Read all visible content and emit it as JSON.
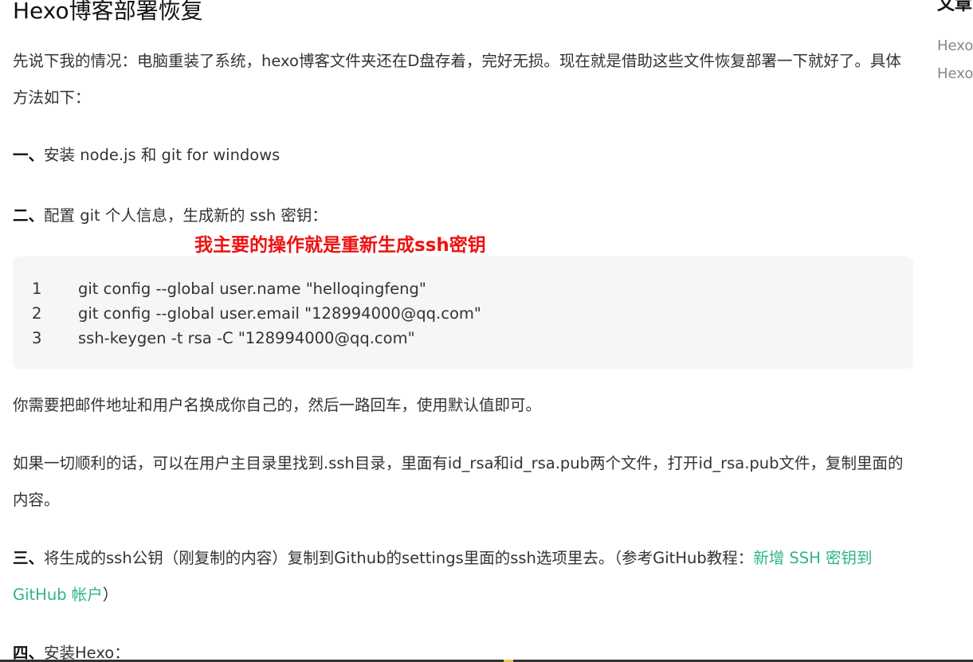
{
  "article": {
    "title": "Hexo博客部署恢复",
    "intro": "先说下我的情况：电脑重装了系统，hexo博客文件夹还在D盘存着，完好无损。现在就是借助这些文件恢复部署一下就好了。具体方法如下：",
    "step1": {
      "label": "一、",
      "text": "安装 node.js 和 git for windows"
    },
    "step2": {
      "label": "二、",
      "text": "配置 git 个人信息，生成新的 ssh 密钥："
    },
    "annotation": "我主要的操作就是重新生成ssh密钥",
    "code": [
      {
        "num": "1",
        "text": "git config --global user.name \"helloqingfeng\""
      },
      {
        "num": "2",
        "text": "git config --global user.email \"128994000@qq.com\""
      },
      {
        "num": "3",
        "text": "ssh-keygen -t rsa -C \"128994000@qq.com\""
      }
    ],
    "note1": "你需要把邮件地址和用户名换成你自己的，然后一路回车，使用默认值即可。",
    "note2": "如果一切顺利的话，可以在用户主目录里找到.ssh目录，里面有id_rsa和id_rsa.pub两个文件，打开id_rsa.pub文件，复制里面的内容。",
    "step3": {
      "label": "三、",
      "text": "将生成的ssh公钥（刚复制的内容）复制到Github的settings里面的ssh选项里去。（参考GitHub教程：",
      "link": "新增 SSH 密钥到 GitHub 帐户",
      "suffix": "）"
    },
    "step4": {
      "label": "四、",
      "text": "安装Hexo："
    }
  },
  "sidebar": {
    "title": "文章",
    "items": [
      "Hexo",
      "Hexo"
    ]
  },
  "colors": {
    "link": "#2fb48a",
    "annotation": "#ee1111",
    "code_bg": "#f6f6f6"
  }
}
